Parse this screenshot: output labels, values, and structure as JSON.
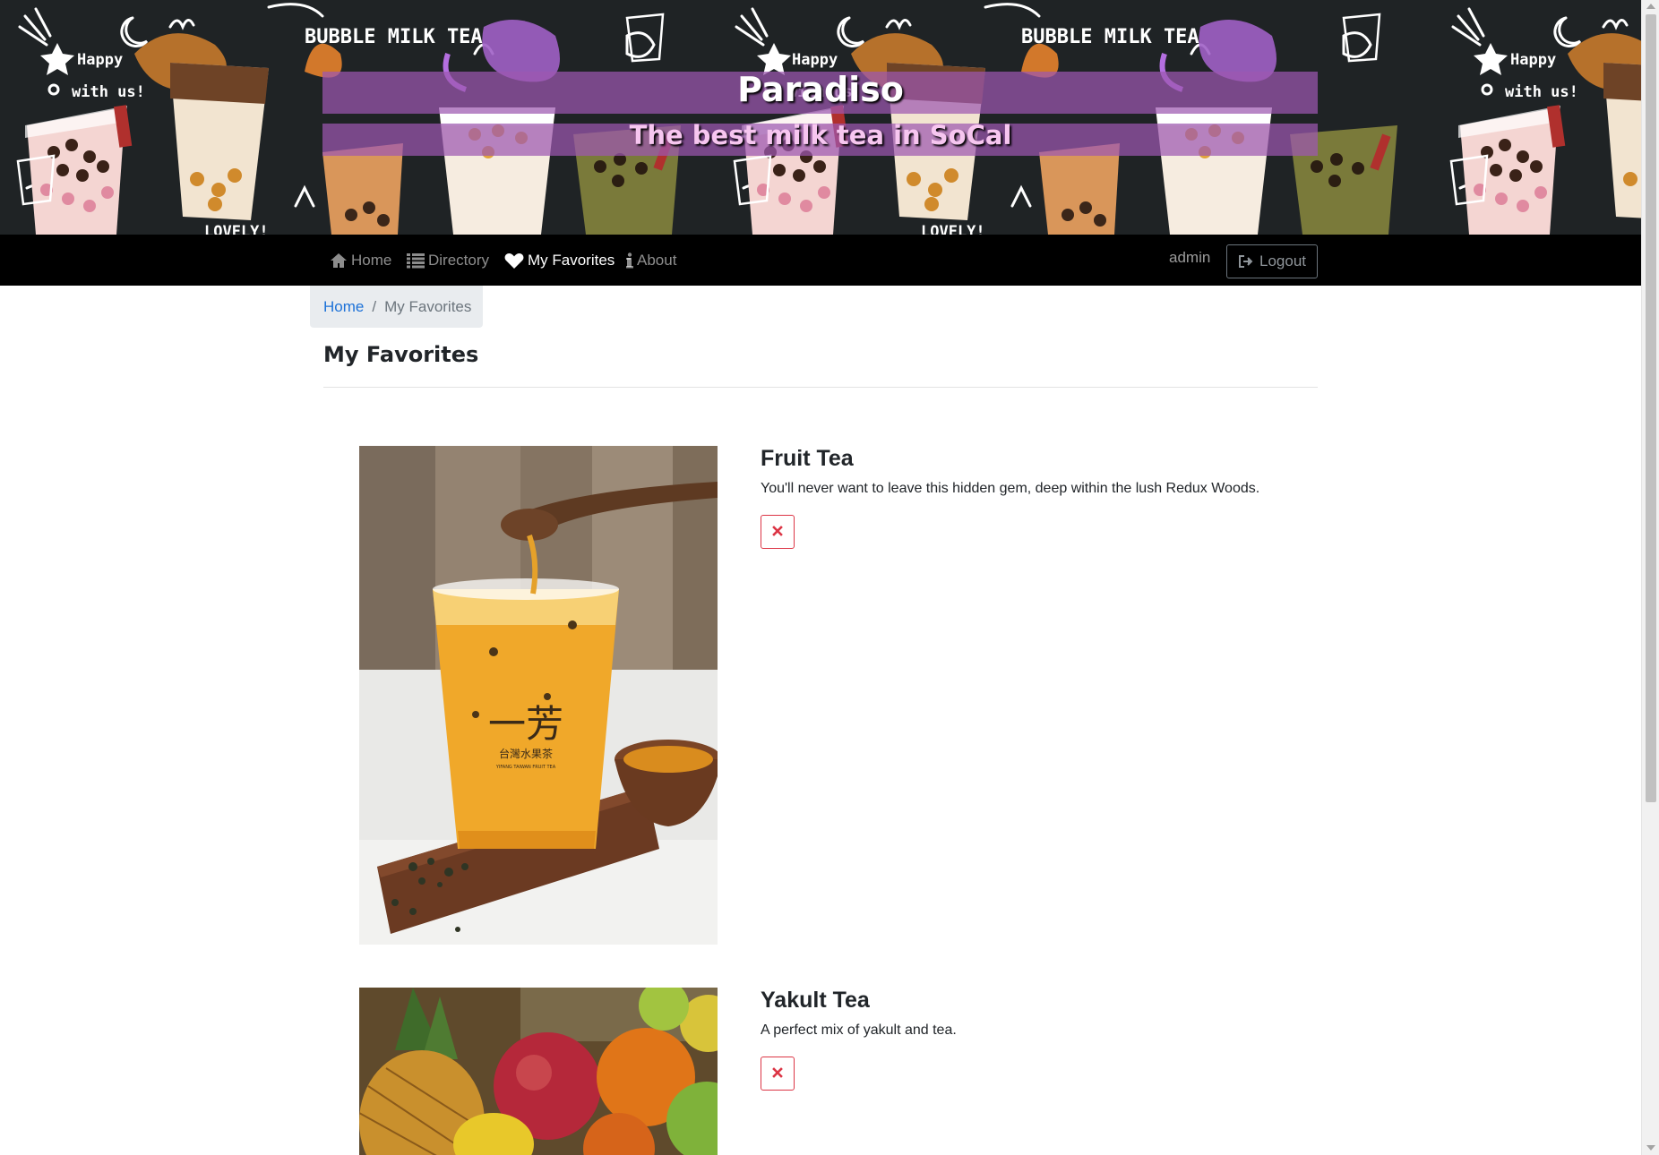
{
  "hero": {
    "title": "Paradiso",
    "subtitle": "The best milk tea in SoCal",
    "artwork_texts": [
      "BUBBLE MILK TEA",
      "Happy",
      "with us!",
      "LOVELY!"
    ]
  },
  "navbar": {
    "items": [
      {
        "label": "Home",
        "icon": "home-icon",
        "active": false
      },
      {
        "label": "Directory",
        "icon": "list-icon",
        "active": false
      },
      {
        "label": "My Favorites",
        "icon": "heart-icon",
        "active": true
      },
      {
        "label": "About",
        "icon": "info-icon",
        "active": false
      }
    ],
    "username": "admin",
    "logout_label": "Logout"
  },
  "breadcrumb": {
    "home_label": "Home",
    "current_label": "My Favorites"
  },
  "page": {
    "heading": "My Favorites"
  },
  "favorites": [
    {
      "name": "Fruit Tea",
      "description": "You'll never want to leave this hidden gem, deep within the lush Redux Woods.",
      "image_alt": "Fruit Tea",
      "cup_text": "一芳",
      "cup_subtext": "台灣水果茶",
      "cup_brand": "YIFANG TAIWAN FRUIT TEA",
      "remove_icon": "close-icon"
    },
    {
      "name": "Yakult Tea",
      "description": "A perfect mix of yakult and tea.",
      "image_alt": "Yakult Tea",
      "remove_icon": "close-icon"
    }
  ],
  "colors": {
    "navbar_bg": "#000000",
    "hero_bg": "#1f2325",
    "hero_band": "#9c58b0",
    "link": "#1d72d8",
    "danger": "#dc3545",
    "breadcrumb_bg": "#e9ecef"
  }
}
